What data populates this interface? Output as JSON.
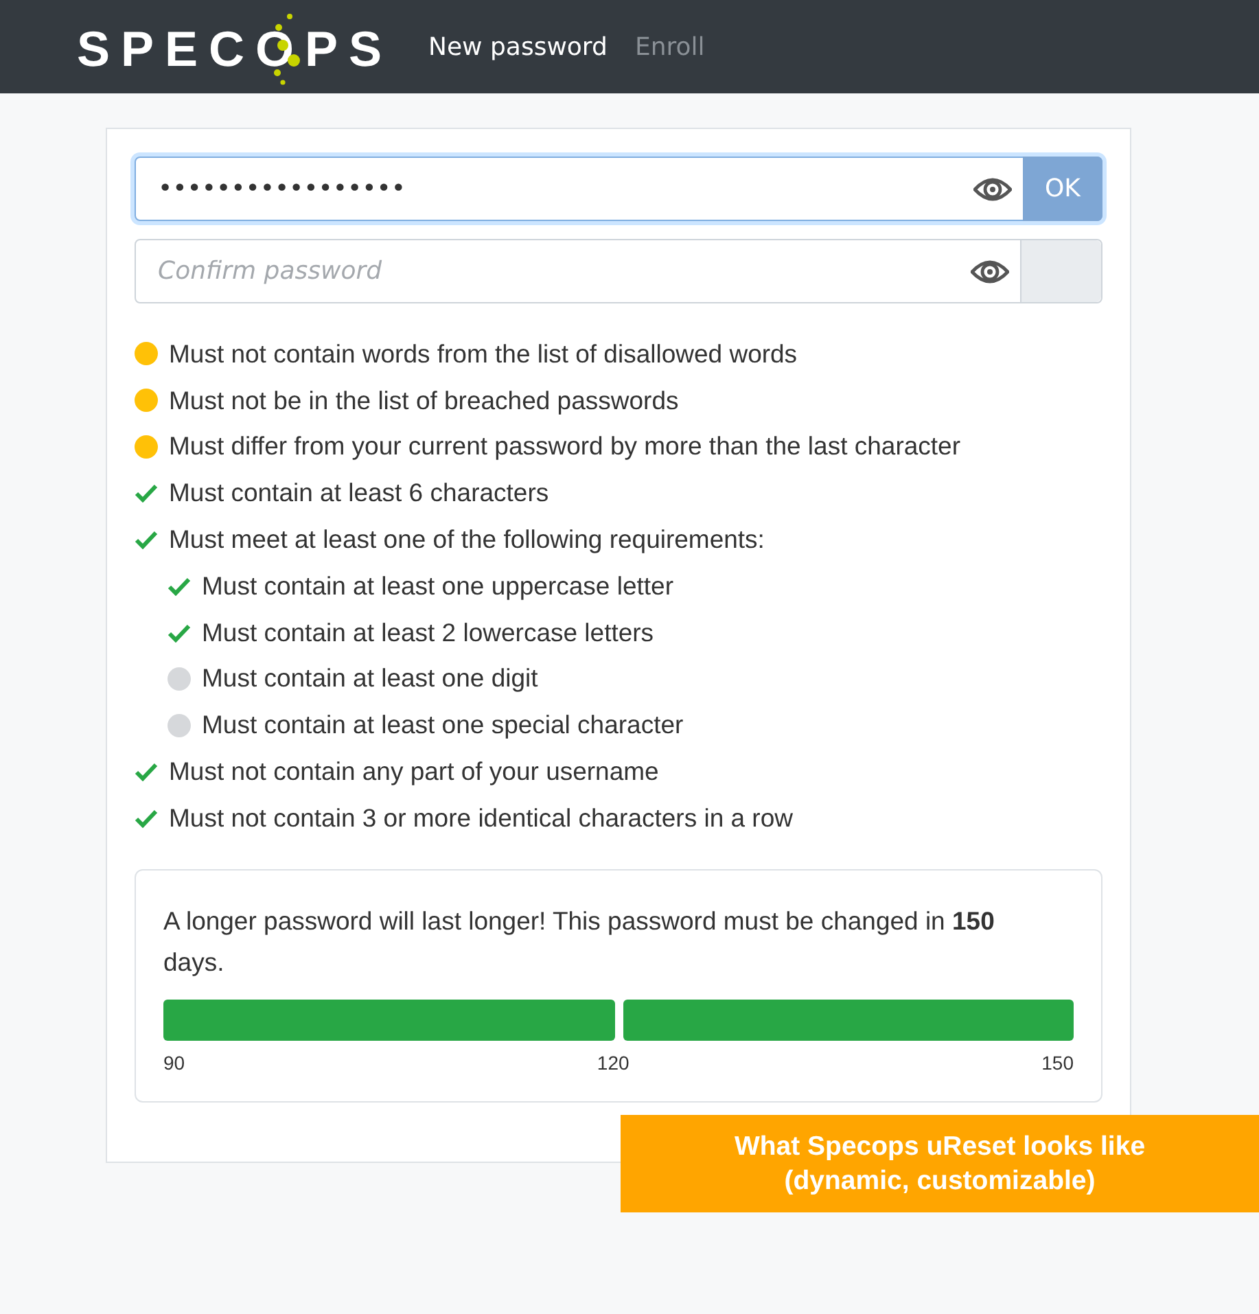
{
  "header": {
    "logo": "SPECOPS",
    "nav": [
      {
        "label": "New password",
        "selected": true
      },
      {
        "label": "Enroll",
        "selected": false
      }
    ]
  },
  "password_field": {
    "value": "•••••••••••••••••",
    "focused": true,
    "button": "OK"
  },
  "confirm_field": {
    "placeholder": "Confirm password",
    "focused": false
  },
  "rules": [
    {
      "text": "Must not contain words from the list of disallowed words",
      "kind": "pending"
    },
    {
      "text": "Must not be in the list of breached passwords",
      "kind": "pending"
    },
    {
      "text": "Must differ from your current password by more than the last character",
      "kind": "pending"
    },
    {
      "text": "Must contain at least 6 characters",
      "kind": "met"
    },
    {
      "text": "Must meet at least one of the following requirements:",
      "kind": "met",
      "children": [
        {
          "text": "Must contain at least one uppercase letter",
          "kind": "met"
        },
        {
          "text": "Must contain at least 2 lowercase letters",
          "kind": "met"
        },
        {
          "text": "Must contain at least one digit",
          "kind": "unmet"
        },
        {
          "text": "Must contain at least one special character",
          "kind": "unmet"
        }
      ]
    },
    {
      "text": "Must not contain any part of your username",
      "kind": "met"
    },
    {
      "text": "Must not contain 3 or more identical characters in a row",
      "kind": "met"
    }
  ],
  "expiry": {
    "message": "A longer password will last longer! This password must be changed in **150** days.",
    "segments": [
      {
        "level": 1
      },
      {
        "level": 1
      }
    ],
    "ticks": [
      "90",
      "120",
      "150"
    ]
  },
  "callout": {
    "lines": [
      "What Specops uReset looks like",
      "(dynamic, customizable)"
    ]
  }
}
